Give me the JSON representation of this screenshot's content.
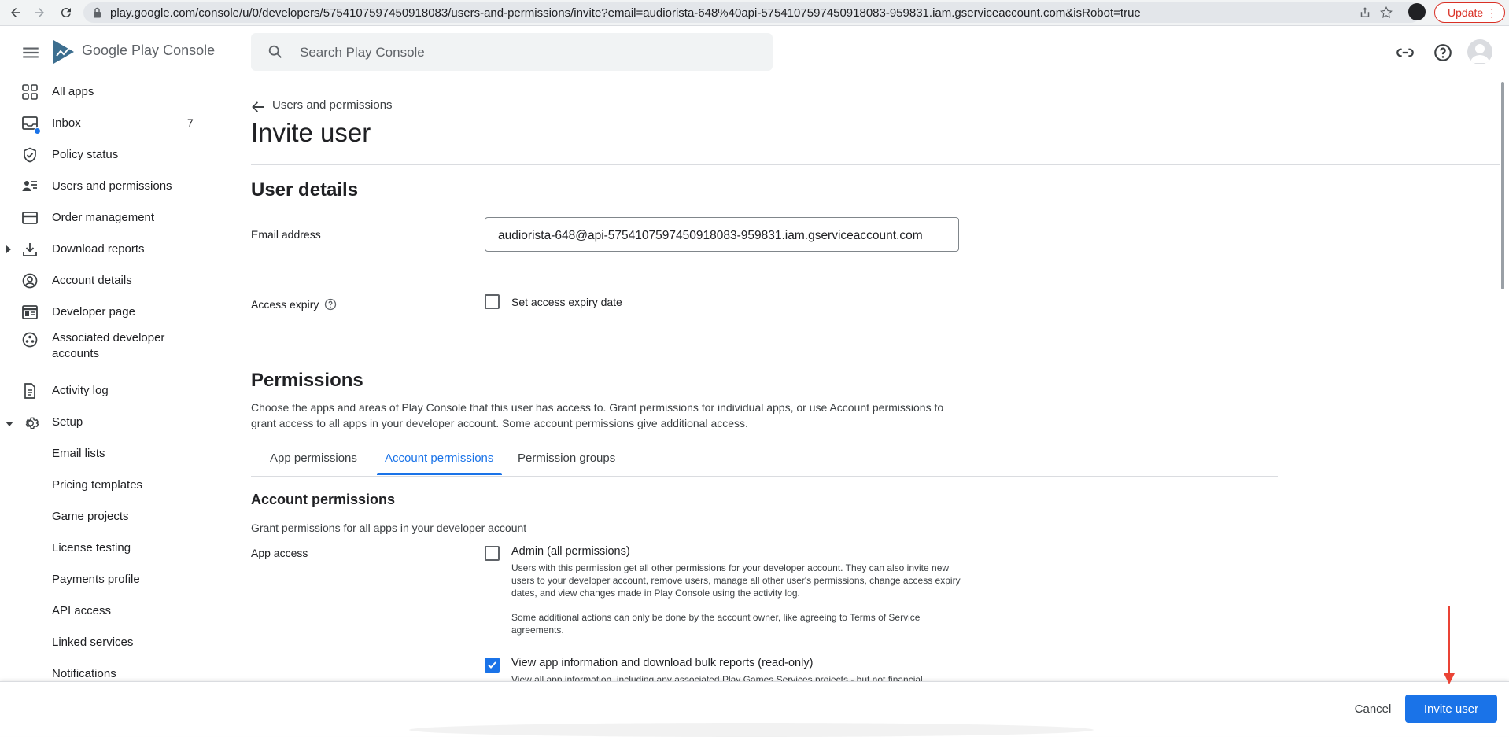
{
  "browser": {
    "url": "play.google.com/console/u/0/developers/5754107597450918083/users-and-permissions/invite?email=audiorista-648%40api-5754107597450918083-959831.iam.gserviceaccount.com&isRobot=true",
    "update_label": "Update"
  },
  "header": {
    "logo_text_google": "Google Play",
    "logo_text_console": "Console",
    "search_placeholder": "Search Play Console"
  },
  "sidebar": {
    "items": [
      {
        "label": "All apps",
        "icon": "grid-icon"
      },
      {
        "label": "Inbox",
        "icon": "inbox-icon",
        "badge": "7"
      },
      {
        "label": "Policy status",
        "icon": "shield-icon"
      },
      {
        "label": "Users and permissions",
        "icon": "users-icon"
      },
      {
        "label": "Order management",
        "icon": "credit-card-icon"
      },
      {
        "label": "Download reports",
        "icon": "download-icon"
      },
      {
        "label": "Account details",
        "icon": "account-circle-icon"
      },
      {
        "label": "Developer page",
        "icon": "web-page-icon"
      },
      {
        "label": "Associated developer accounts",
        "icon": "group-circle-icon"
      },
      {
        "label": "Activity log",
        "icon": "document-icon"
      },
      {
        "label": "Setup",
        "icon": "gear-icon"
      }
    ],
    "setup_items": [
      "Email lists",
      "Pricing templates",
      "Game projects",
      "License testing",
      "Payments profile",
      "API access",
      "Linked services",
      "Notifications"
    ]
  },
  "main": {
    "breadcrumb": "Users and permissions",
    "title": "Invite user",
    "user_details": {
      "heading": "User details",
      "email_label": "Email address",
      "email_value": "audiorista-648@api-5754107597450918083-959831.iam.gserviceaccount.com",
      "expiry_label": "Access expiry",
      "expiry_checkbox_label": "Set access expiry date"
    },
    "permissions": {
      "heading": "Permissions",
      "description": "Choose the apps and areas of Play Console that this user has access to. Grant permissions for individual apps, or use Account permissions to grant access to all apps in your developer account. Some account permissions give additional access.",
      "tabs": [
        "App permissions",
        "Account permissions",
        "Permission groups"
      ],
      "active_tab": "Account permissions",
      "account_heading": "Account permissions",
      "account_sub": "Grant permissions for all apps in your developer account",
      "app_access_label": "App access",
      "admin": {
        "title": "Admin (all permissions)",
        "checked": false,
        "desc1": "Users with this permission get all other permissions for your developer account. They can also invite new users to your developer account, remove users, manage all other user's permissions, change access expiry dates, and view changes made in Play Console using the activity log.",
        "desc2": "Some additional actions can only be done by the account owner, like agreeing to Terms of Service agreements."
      },
      "view_info": {
        "title": "View app information and download bulk reports (read-only)",
        "checked": true,
        "desc": "View all app information, including any associated Play Games Services projects - but not financial"
      }
    }
  },
  "footer": {
    "cancel_label": "Cancel",
    "invite_label": "Invite user"
  },
  "colors": {
    "accent": "#1a73e8",
    "annotation": "#ea4335"
  }
}
